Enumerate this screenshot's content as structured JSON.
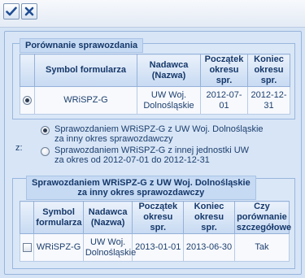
{
  "toolbar": {
    "ok_icon": "checkmark-icon",
    "close_icon": "close-icon"
  },
  "section1": {
    "legend": "Porównanie sprawozdania",
    "headers": [
      "Symbol formularza",
      "Nadawca (Nazwa)",
      "Początek okresu spr.",
      "Koniec okresu spr."
    ],
    "header_lines": {
      "nadawca": [
        "Nadawca",
        "(Nazwa)"
      ],
      "poczatek": [
        "Początek",
        "okresu",
        "spr."
      ],
      "koniec": [
        "Koniec",
        "okresu",
        "spr."
      ]
    },
    "row": {
      "selected": true,
      "symbol": "WRiSPZ-G",
      "nadawca_lines": [
        "UW Woj.",
        "Dolnośląskie"
      ],
      "start": "2012-07-01",
      "end": "2012-12-31"
    }
  },
  "compare": {
    "label": "z:",
    "options": [
      {
        "lines": [
          "Sprawozdaniem WRiSPZ-G z UW Woj. Dolnośląskie",
          "za inny okres sprawozdawczy"
        ],
        "selected": true
      },
      {
        "lines": [
          "Sprawozdaniem WRiSPZ-G z innej jednostki UW",
          "za okres od 2012-07-01 do 2012-12-31"
        ],
        "selected": false
      }
    ]
  },
  "section2": {
    "legend_lines": [
      "Sprawozdaniem WRiSPZ-G z UW Woj. Dolnośląskie",
      "za inny okres sprawozdawczy"
    ],
    "headers": {
      "symbol": [
        "Symbol",
        "formularza"
      ],
      "nadawca": [
        "Nadawca",
        "(Nazwa)"
      ],
      "poczatek": [
        "Początek",
        "okresu spr."
      ],
      "koniec": [
        "Koniec",
        "okresu spr."
      ],
      "porownanie": [
        "Czy",
        "porównanie",
        "szczegółowe"
      ]
    },
    "row": {
      "checked": false,
      "symbol": "WRiSPZ-G",
      "nadawca_lines": [
        "UW Woj.",
        "Dolnośląskie"
      ],
      "start": "2013-01-01",
      "end": "2013-06-30",
      "detailed": "Tak"
    }
  }
}
